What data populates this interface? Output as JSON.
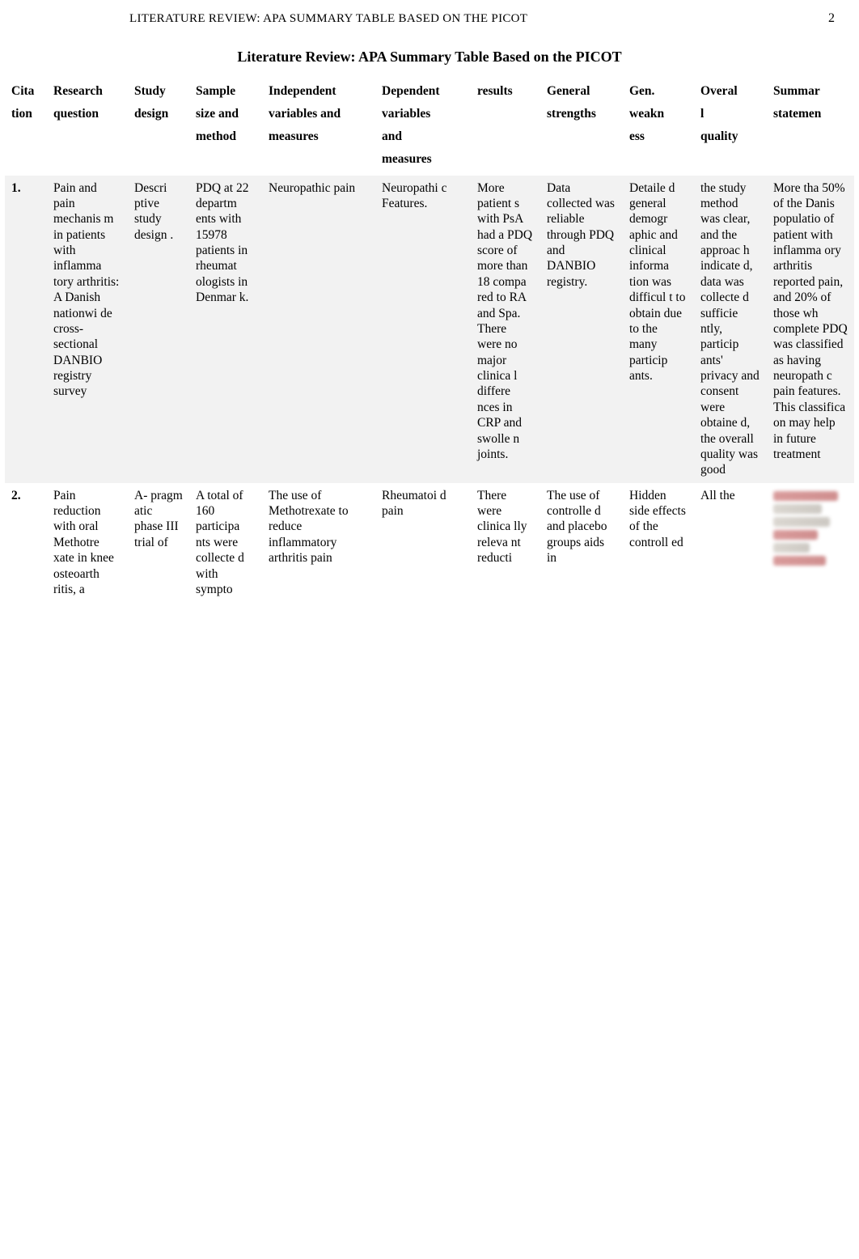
{
  "running_head": {
    "left": "LITERATURE REVIEW: APA SUMMARY TABLE BASED ON THE PICOT",
    "right": "2"
  },
  "title": "Literature Review: APA Summary Table Based on the PICOT",
  "table": {
    "headers": {
      "citation": "Cita\ntion",
      "question": "Research\nquestion",
      "study": "Study\ndesign",
      "sample": "Sample\nsize and\nmethod",
      "independent": "Independent\nvariables and\nmeasures",
      "dependent": "Dependent\nvariables\nand\nmeasures",
      "results": "results",
      "general": "General\nstrengths",
      "gen_weak": "Gen.\nweakn\ness",
      "overall": "Overal\nl\nquality",
      "summary": "Summar\nstatemen"
    },
    "rows": [
      {
        "citation": "1.",
        "question": "Pain and pain mechanis m in patients with inflamma tory arthritis: A Danish nationwi de cross-sectional DANBIO registry survey",
        "study": "Descri ptive study design .",
        "sample": "PDQ at 22 departm ents with 15978 patients in rheumat ologists in Denmar k.",
        "independent": "Neuropathic pain",
        "dependent": "Neuropathi c Features.",
        "results": "More patient s with PsA had a PDQ score of more than 18 compa red to RA and Spa. There were no major clinica l differe nces in CRP and swolle n joints.",
        "general": "Data collected was reliable through PDQ and DANBIO registry.",
        "gen_weak": "Detaile d general demogr aphic and clinical informa tion was difficul t to obtain due to the many particip ants.",
        "overall": "the study method was clear, and the approac h indicate d, data was collecte d sufficie ntly, particip ants' privacy and consent were obtaine d, the overall quality was good",
        "summary": "More tha 50% of the Danis populatio of patient with inflamma ory arthritis reported pain, and 20% of those wh complete PDQ was classified as having neuropath c pain features. This classifica on may help in future treatment"
      },
      {
        "citation": "2.",
        "question": "Pain reduction with oral Methotre xate in knee osteoarth ritis, a",
        "study": "A- pragm atic phase III trial of",
        "sample": "A total of 160 participa nts were collecte d with sympto",
        "independent": "The use of Methotrexate to reduce inflammatory arthritis pain",
        "dependent": "Rheumatoi d pain",
        "results": "There were clinica lly releva nt reducti",
        "general": "The use of controlle d and placebo groups aids in",
        "gen_weak": "Hidden side effects of the controll ed",
        "overall": "All the",
        "summary": ""
      }
    ]
  }
}
